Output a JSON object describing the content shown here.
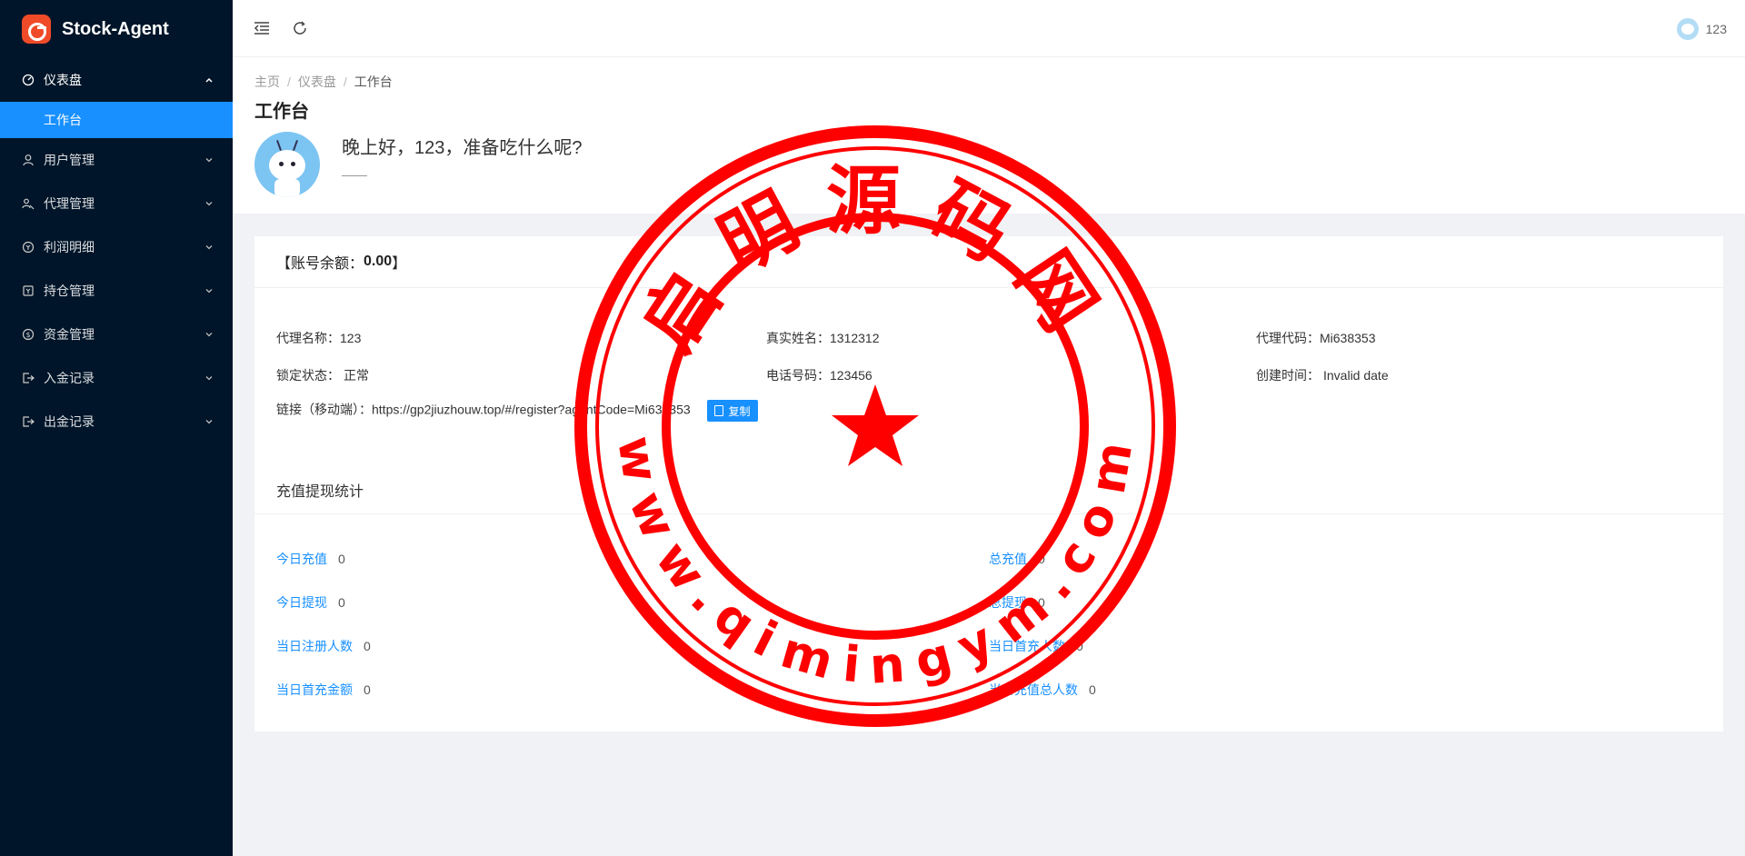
{
  "app": {
    "name": "Stock-Agent"
  },
  "sidebar": {
    "dashboard": {
      "label": "仪表盘",
      "child": "工作台"
    },
    "items": [
      {
        "label": "用户管理",
        "icon": "user-icon"
      },
      {
        "label": "代理管理",
        "icon": "team-icon"
      },
      {
        "label": "利润明细",
        "icon": "profit-icon"
      },
      {
        "label": "持仓管理",
        "icon": "position-icon"
      },
      {
        "label": "资金管理",
        "icon": "money-icon"
      },
      {
        "label": "入金记录",
        "icon": "deposit-icon"
      },
      {
        "label": "出金记录",
        "icon": "withdraw-icon"
      }
    ]
  },
  "header": {
    "username": "123"
  },
  "breadcrumb": [
    "主页",
    "仪表盘",
    "工作台"
  ],
  "page": {
    "title": "工作台",
    "greeting": "晚上好，123，准备吃什么呢?"
  },
  "account": {
    "balance_prefix": "【账号余额：",
    "balance": "0.00",
    "balance_suffix": "】"
  },
  "agent_info": {
    "name_label": "代理名称：",
    "name": "123",
    "real_name_label": "真实姓名：",
    "real_name": "1312312",
    "code_label": "代理代码：",
    "code": "Mi638353",
    "lock_label": "锁定状态：",
    "lock": "正常",
    "phone_label": "电话号码：",
    "phone": "123456",
    "created_label": "创建时间：",
    "created": "Invalid date",
    "link_label": "链接（移动端）：",
    "link": "https://gp2jiuzhouw.top/#/register?agentCode=Mi638353",
    "copy_label": "复制"
  },
  "stats": {
    "title": "充值提现统计",
    "left": [
      {
        "label": "今日充值",
        "value": "0"
      },
      {
        "label": "今日提现",
        "value": "0"
      },
      {
        "label": "当日注册人数",
        "value": "0"
      },
      {
        "label": "当日首充金额",
        "value": "0"
      }
    ],
    "right": [
      {
        "label": "总充值",
        "value": "0"
      },
      {
        "label": "总提现",
        "value": "0"
      },
      {
        "label": "当日首充人数",
        "value": "0"
      },
      {
        "label": "当日充值总人数",
        "value": "0"
      }
    ]
  },
  "watermark": {
    "top_text": "启明源码网",
    "bottom_text": "www.qimingym.com",
    "color": "#ff0000"
  }
}
